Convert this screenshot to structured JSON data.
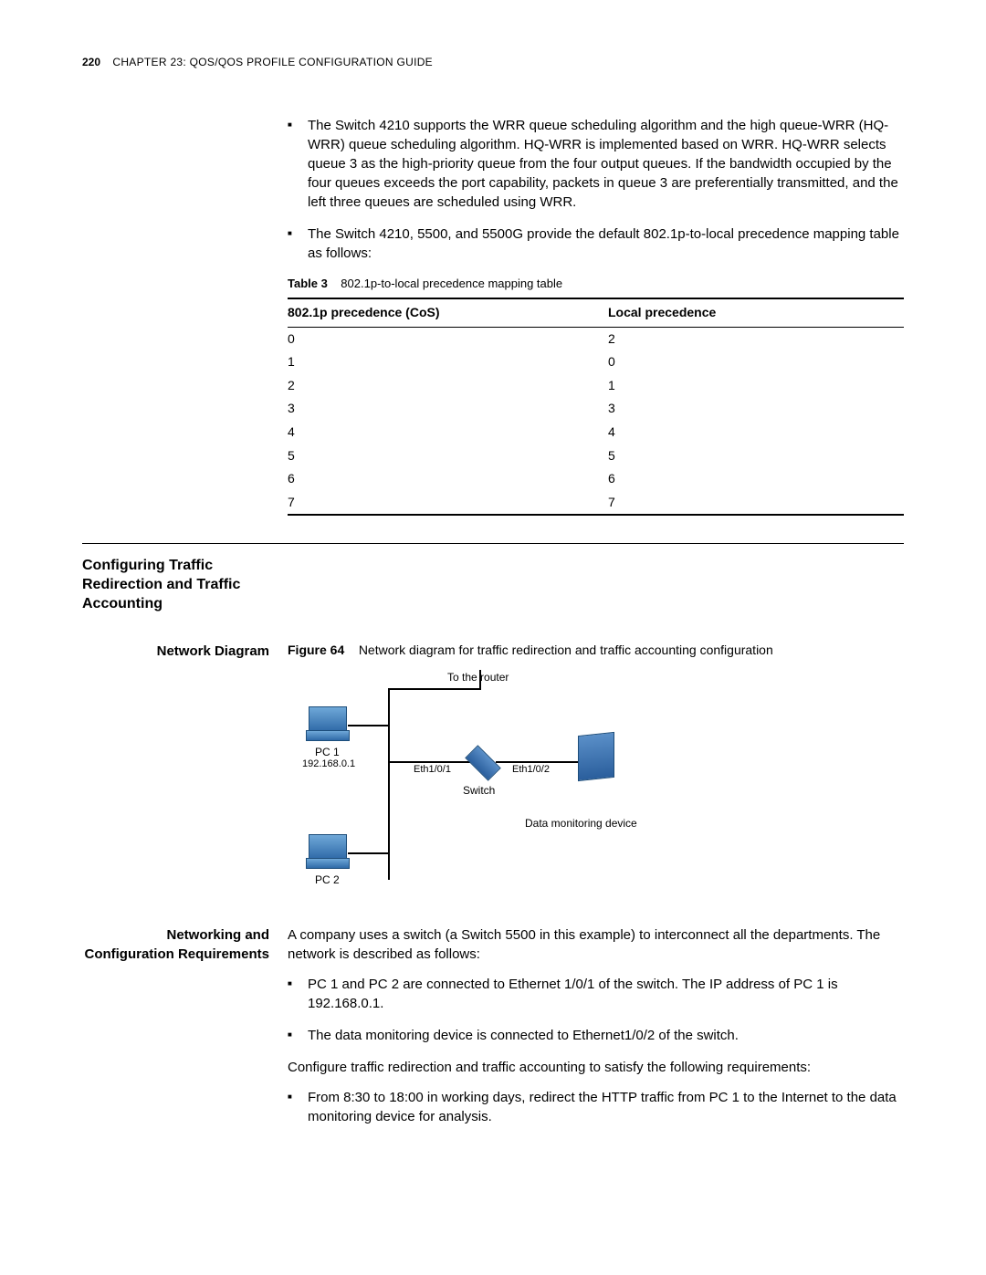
{
  "header": {
    "page_number": "220",
    "chapter_small": "C",
    "chapter_text": "HAPTER 23: QOS/QOS PROFILE CONFIGURATION GUIDE"
  },
  "bullets_top": [
    "The Switch 4210 supports the WRR queue scheduling algorithm and the high queue-WRR (HQ-WRR) queue scheduling algorithm. HQ-WRR is implemented based on WRR. HQ-WRR selects queue 3 as the high-priority queue from the four output queues. If the bandwidth occupied by the four queues exceeds the port capability, packets in queue 3 are preferentially transmitted, and the left three queues are scheduled using WRR.",
    "The Switch 4210, 5500, and 5500G provide the default 802.1p-to-local precedence mapping table as follows:"
  ],
  "table3": {
    "label": "Table 3",
    "caption": "802.1p-to-local precedence mapping table",
    "col1": "802.1p precedence (CoS)",
    "col2": "Local precedence",
    "rows": [
      {
        "a": "0",
        "b": "2"
      },
      {
        "a": "1",
        "b": "0"
      },
      {
        "a": "2",
        "b": "1"
      },
      {
        "a": "3",
        "b": "3"
      },
      {
        "a": "4",
        "b": "4"
      },
      {
        "a": "5",
        "b": "5"
      },
      {
        "a": "6",
        "b": "6"
      },
      {
        "a": "7",
        "b": "7"
      }
    ]
  },
  "section_heading": "Configuring Traffic Redirection and Traffic Accounting",
  "network_diagram": {
    "label_col": "Network Diagram",
    "fig_label": "Figure 64",
    "fig_caption": "Network diagram for traffic redirection and traffic accounting configuration",
    "labels": {
      "to_router": "To the router",
      "pc1": "PC 1",
      "pc1_ip": "192.168.0.1",
      "pc2": "PC 2",
      "eth1": "Eth1/0/1",
      "eth2": "Eth1/0/2",
      "switch": "Switch",
      "monitor": "Data monitoring device"
    }
  },
  "netreq": {
    "label_col": "Networking and Configuration Requirements",
    "intro": "A company uses a switch (a Switch 5500 in this example) to interconnect all the departments. The network is described as follows:",
    "desc_bullets": [
      "PC 1 and PC 2 are connected to Ethernet 1/0/1 of the switch. The IP address of PC 1 is 192.168.0.1.",
      "The data monitoring device is connected to Ethernet1/0/2 of the switch."
    ],
    "mid": "Configure traffic redirection and traffic accounting to satisfy the following requirements:",
    "req_bullets": [
      "From 8:30 to 18:00 in working days, redirect the HTTP traffic from PC 1 to the Internet to the data monitoring device for analysis."
    ]
  }
}
